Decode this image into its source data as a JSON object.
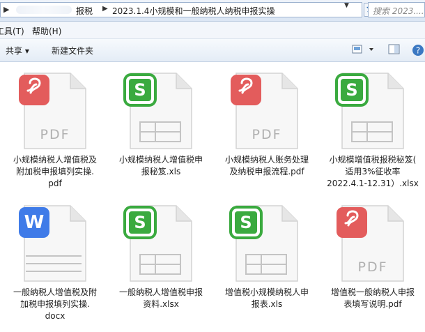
{
  "address": {
    "segment1": "报税",
    "segment2": "2023.1.4小规模和一般纳税人纳税申报实操"
  },
  "search": {
    "placeholder": "搜索 2023...."
  },
  "menu": {
    "items": [
      "工具(T)",
      "帮助(H)"
    ]
  },
  "toolbar": {
    "share_label": "共享 ▾",
    "new_folder_label": "新建文件夹"
  },
  "colors": {
    "pdf": "#e35c5c",
    "xls": "#3aaa3f",
    "doc": "#3f7be8"
  },
  "files": [
    {
      "type": "pdf",
      "icon": "wps-pdf-icon",
      "lines": [
        "小规模纳税人增值税及",
        "附加税申报填列实操.",
        "pdf"
      ]
    },
    {
      "type": "xls",
      "icon": "wps-sheet-icon",
      "lines": [
        "小规模纳税人增值税申",
        "报秘笈.xls"
      ]
    },
    {
      "type": "pdf",
      "icon": "wps-pdf-icon",
      "lines": [
        "小规模纳税人账务处理",
        "及纳税申报流程.pdf"
      ]
    },
    {
      "type": "xls",
      "icon": "wps-sheet-icon",
      "lines": [
        "小规模增值税报税秘笈(",
        "适用3%征收率",
        "2022.4.1-12.31）.xlsx"
      ]
    },
    {
      "type": "doc",
      "icon": "wps-writer-icon",
      "lines": [
        "一般纳税人增值税及附",
        "加税申报填列实操.",
        "docx"
      ]
    },
    {
      "type": "xls",
      "icon": "wps-sheet-icon",
      "lines": [
        "一般纳税人增值税申报",
        "资料.xlsx"
      ]
    },
    {
      "type": "xls",
      "icon": "wps-sheet-icon",
      "lines": [
        "增值税小规模纳税人申",
        "报表.xls"
      ]
    },
    {
      "type": "pdf",
      "icon": "wps-pdf-icon",
      "lines": [
        "增值税一般纳税人申报",
        "表填写说明.pdf"
      ]
    }
  ]
}
